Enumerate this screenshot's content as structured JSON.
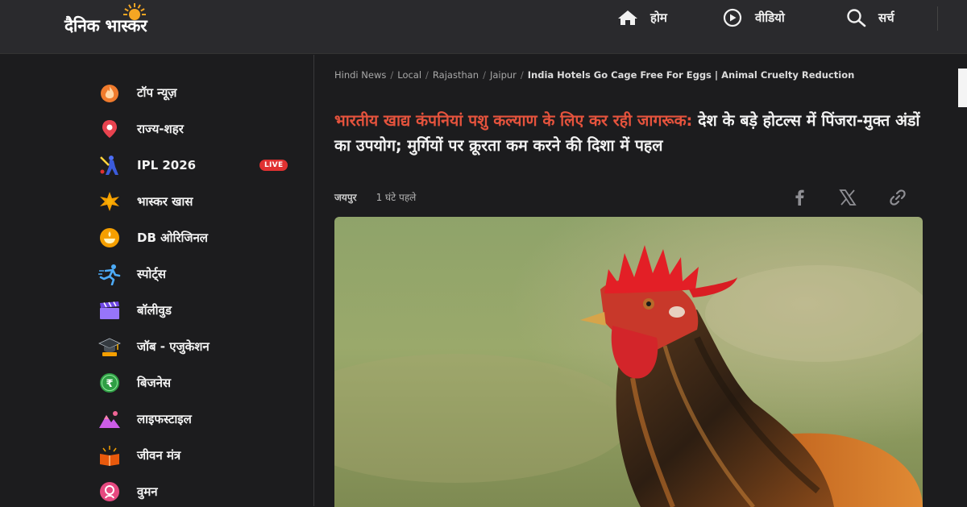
{
  "header": {
    "logo_text": "दैनिक भास्कर",
    "nav": [
      {
        "label": "होम",
        "icon": "home-icon"
      },
      {
        "label": "वीडियो",
        "icon": "play-circle-icon"
      },
      {
        "label": "सर्च",
        "icon": "search-icon"
      }
    ]
  },
  "sidebar": {
    "items": [
      {
        "label": "टॉप न्यूज़",
        "icon": "flame-icon"
      },
      {
        "label": "राज्य-शहर",
        "icon": "location-pin-icon"
      },
      {
        "label": "IPL 2026",
        "icon": "cricket-player-icon",
        "badge": "LIVE"
      },
      {
        "label": "भास्कर खास",
        "icon": "star-burst-icon"
      },
      {
        "label": "DB ओरिजिनल",
        "icon": "diya-lamp-icon"
      },
      {
        "label": "स्पोर्ट्स",
        "icon": "running-man-icon"
      },
      {
        "label": "बॉलीवुड",
        "icon": "clapperboard-icon"
      },
      {
        "label": "जॉब - एजुकेशन",
        "icon": "graduation-cap-icon"
      },
      {
        "label": "बिजनेस",
        "icon": "rupee-coin-icon"
      },
      {
        "label": "लाइफस्टाइल",
        "icon": "mountain-icon"
      },
      {
        "label": "जीवन मंत्र",
        "icon": "book-sunrise-icon"
      },
      {
        "label": "वुमन",
        "icon": "woman-icon"
      }
    ]
  },
  "article": {
    "breadcrumb": [
      "Hindi News",
      "Local",
      "Rajasthan",
      "Jaipur"
    ],
    "breadcrumb_current": "India Hotels Go Cage Free For Eggs | Animal Cruelty Reduction",
    "headline_kicker": "भारतीय खाद्य कंपनियां पशु कल्याण के लिए कर रही जागरूक:",
    "headline_rest": " देश के बड़े होटल्स में पिंजरा-मुक्त अंडों का उपयोग; मुर्गियों पर क्रूरता कम करने की दिशा में पहल",
    "place": "जयपुर",
    "time": "1 घंटे पहले",
    "share": [
      "facebook-icon",
      "x-icon",
      "link-icon"
    ]
  },
  "colors": {
    "accent_red": "#e5533d",
    "live_badge": "#e03131",
    "background": "#1c1c1e",
    "header_bg": "#2a2a2d"
  }
}
